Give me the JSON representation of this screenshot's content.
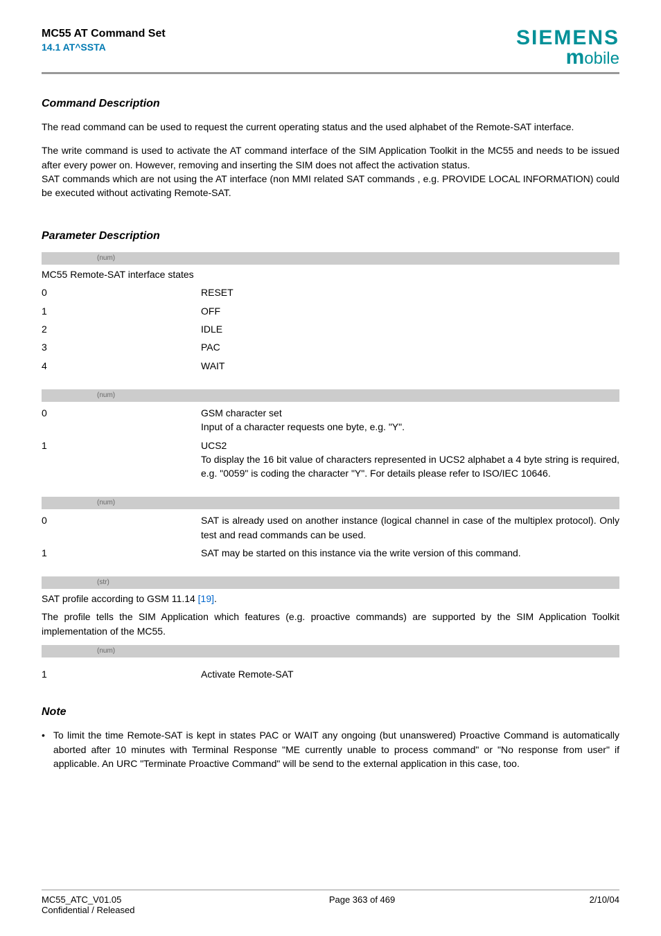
{
  "header": {
    "doc_title": "MC55 AT Command Set",
    "doc_section": "14.1 AT^SSTA",
    "brand": "SIEMENS",
    "brand_sub_m": "m",
    "brand_sub_obile": "obile"
  },
  "cmd_desc": {
    "heading": "Command Description",
    "p1": "The read command can be used to request the current operating status and the used alphabet of the Remote-SAT interface.",
    "p2": "The write command is used to activate the AT command interface of the SIM Application Toolkit in the MC55 and needs to be issued after every power on. However, removing and inserting the SIM does not affect the activation status.",
    "p3": "SAT commands which are not using the AT interface (non MMI related SAT commands , e.g. PROVIDE LOCAL INFORMATION) could be executed without activating Remote-SAT."
  },
  "param_desc": {
    "heading": "Parameter Description",
    "groups": [
      {
        "tag": "(num)",
        "label": "MC55 Remote-SAT interface states",
        "rows": [
          {
            "key": "0",
            "val": "RESET"
          },
          {
            "key": "1",
            "val": "OFF"
          },
          {
            "key": "2",
            "val": "IDLE"
          },
          {
            "key": "3",
            "val": "PAC"
          },
          {
            "key": "4",
            "val": "WAIT"
          }
        ]
      },
      {
        "tag": "(num)",
        "label": "",
        "rows": [
          {
            "key": "0",
            "val": "GSM character set\nInput of a character requests one byte, e.g. \"Y\"."
          },
          {
            "key": "1",
            "val": "UCS2\nTo display the 16 bit value of characters represented in UCS2 alphabet a 4 byte string is required, e.g. \"0059\" is coding the character \"Y\". For details please refer to ISO/IEC 10646."
          }
        ]
      },
      {
        "tag": "(num)",
        "label": "",
        "rows": [
          {
            "key": "0",
            "val": "SAT is already used on another instance (logical channel in case of the multiplex protocol). Only test and read commands can be used."
          },
          {
            "key": "1",
            "val": "SAT may be started on this instance via the write version of this command."
          }
        ]
      },
      {
        "tag": "(str)",
        "label_pre": "SAT profile according to GSM 11.14 ",
        "label_link": "[19]",
        "label_post": ".",
        "desc": "The profile tells the SIM Application which features (e.g. proactive commands) are supported by the SIM Application Toolkit implementation of the MC55.",
        "rows": []
      },
      {
        "tag": "(num)",
        "label": "",
        "rows": [
          {
            "key": "1",
            "val": "Activate Remote-SAT"
          }
        ]
      }
    ]
  },
  "note": {
    "heading": "Note",
    "bullet": "•",
    "text": "To limit the time Remote-SAT is kept in states PAC or WAIT any ongoing (but unanswered) Proactive Command is automatically aborted after 10 minutes with Terminal Response \"ME currently unable to process command\" or \"No response from user\" if applicable. An URC \"Terminate Proactive Command\" will be send to the external application in this case, too."
  },
  "footer": {
    "left1": "MC55_ATC_V01.05",
    "left2": "Confidential / Released",
    "center": "Page 363 of 469",
    "right": "2/10/04"
  }
}
